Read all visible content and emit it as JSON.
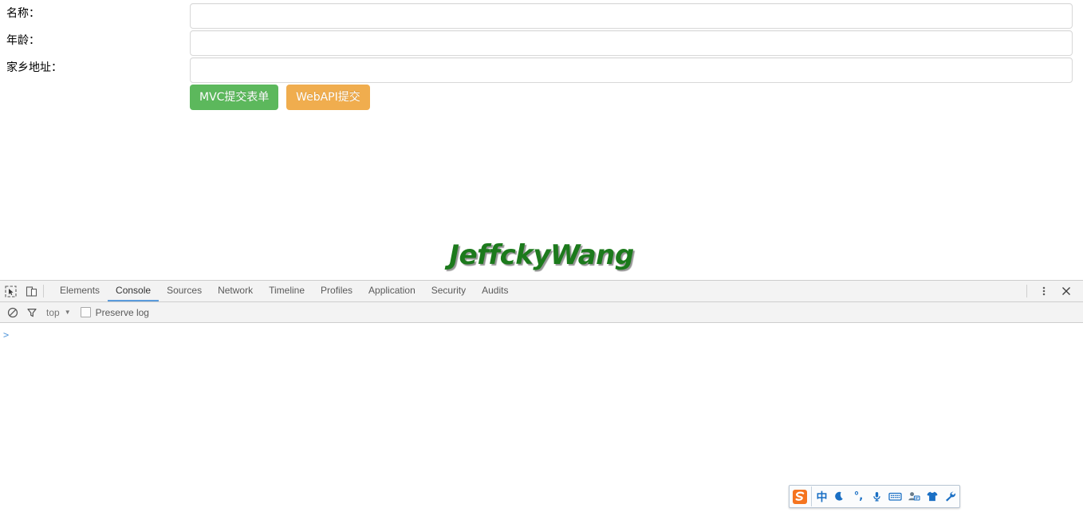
{
  "page": {
    "form": {
      "rows": [
        {
          "label": "名称：",
          "value": "",
          "placeholder": ""
        },
        {
          "label": "年龄：",
          "value": "",
          "placeholder": ""
        },
        {
          "label": "家乡地址：",
          "value": "",
          "placeholder": ""
        }
      ],
      "buttons": {
        "mvc_submit": "MVC提交表单",
        "webapi_submit": "WebAPI提交"
      },
      "colors": {
        "mvc_button": "#5cb85c",
        "webapi_button": "#f0ad4e",
        "input_border": "#d8d8d8"
      }
    },
    "watermark": {
      "text": "JeffckyWang",
      "color": "#1c7a1c"
    }
  },
  "devtools": {
    "tools": [
      {
        "name": "inspect-element-icon",
        "label": "Inspect element"
      },
      {
        "name": "device-toolbar-icon",
        "label": "Toggle device toolbar"
      }
    ],
    "tabs": [
      {
        "label": "Elements",
        "active": false
      },
      {
        "label": "Console",
        "active": true
      },
      {
        "label": "Sources",
        "active": false
      },
      {
        "label": "Network",
        "active": false
      },
      {
        "label": "Timeline",
        "active": false
      },
      {
        "label": "Profiles",
        "active": false
      },
      {
        "label": "Application",
        "active": false
      },
      {
        "label": "Security",
        "active": false
      },
      {
        "label": "Audits",
        "active": false
      }
    ],
    "active_tab_color": "#5a9bdc",
    "right_actions": [
      {
        "name": "more-options-icon",
        "label": "Customize and control DevTools"
      },
      {
        "name": "close-icon",
        "label": "Close DevTools"
      }
    ],
    "console_toolbar": {
      "clear_label": "Clear console",
      "filter_label": "Filter",
      "context": "top",
      "caret": "▼",
      "preserve_log_label": "Preserve log",
      "preserve_log_checked": false
    },
    "console": {
      "prompt": ">",
      "prompt_color": "#5a9bdc",
      "messages": []
    }
  },
  "ime": {
    "name": "sogou-input-toolbar",
    "items": [
      {
        "name": "sogou-logo-icon",
        "label": "搜狗"
      },
      {
        "name": "chinese-mode-icon",
        "label": "中"
      },
      {
        "name": "moon-mode-icon",
        "label": "简繁切换"
      },
      {
        "name": "punctuation-icon",
        "label": "°,"
      },
      {
        "name": "microphone-icon",
        "label": "语音输入"
      },
      {
        "name": "soft-keyboard-icon",
        "label": "软键盘"
      },
      {
        "name": "user-center-icon",
        "label": "用户中心"
      },
      {
        "name": "skin-icon",
        "label": "换肤"
      },
      {
        "name": "toolbox-icon",
        "label": "工具箱"
      }
    ],
    "accent_color": "#1a6fc4",
    "logo_color": "#f5741f"
  }
}
